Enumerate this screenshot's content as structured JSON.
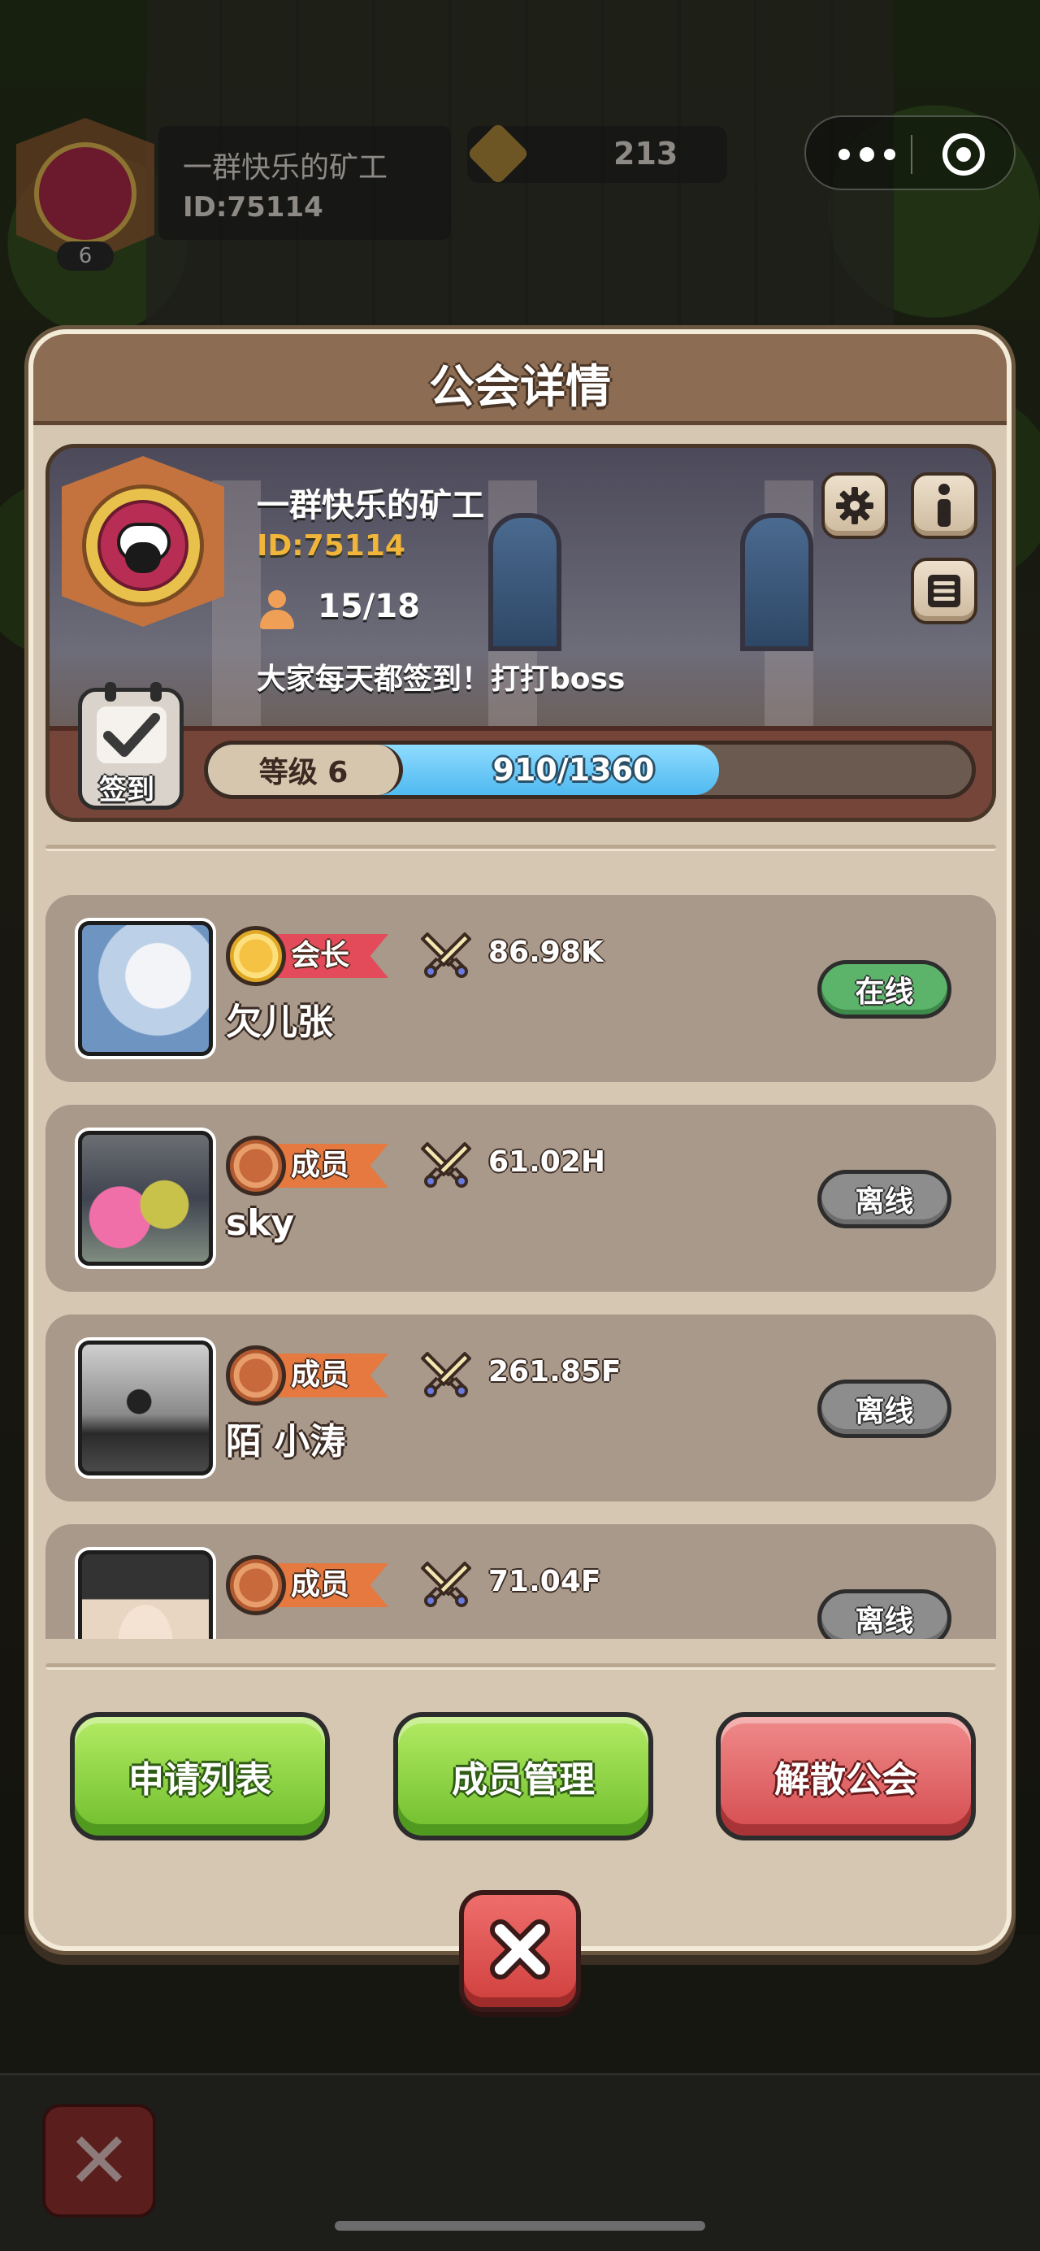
{
  "hud": {
    "guild_name": "一群快乐的矿工",
    "guild_id": "ID:75114",
    "guild_level": "6",
    "crown_count": "213"
  },
  "panel": {
    "title": "公会详情"
  },
  "guild": {
    "name": "一群快乐的矿工",
    "id": "ID:75114",
    "members_count": "15/18",
    "description": "大家每天都签到！打打boss",
    "checkin_label": "签到",
    "level_label": "等级 6",
    "exp_text": "910/1360",
    "exp_current": 910,
    "exp_max": 1360
  },
  "members": [
    {
      "role": "会长",
      "role_type": "leader",
      "power": "86.98K",
      "name": "欠儿张",
      "status": "在线",
      "status_type": "online"
    },
    {
      "role": "成员",
      "role_type": "member",
      "power": "61.02H",
      "name": "sky",
      "status": "离线",
      "status_type": "offline"
    },
    {
      "role": "成员",
      "role_type": "member",
      "power": "261.85F",
      "name": "陌 小涛",
      "status": "离线",
      "status_type": "offline"
    },
    {
      "role": "成员",
      "role_type": "member",
      "power": "71.04F",
      "name": "",
      "status": "离线",
      "status_type": "offline"
    }
  ],
  "actions": {
    "apply_list": "申请列表",
    "member_manage": "成员管理",
    "disband": "解散公会"
  },
  "colors": {
    "panel_bg": "#d5c7b2",
    "header_bg": "#8c6c52",
    "exp_fill": "#4fb9f0",
    "online": "#5cb46a",
    "offline": "#8d8d8d",
    "green_button": "#6fbe2d",
    "red_button": "#d44c4f",
    "guild_id_color": "#f1b53a"
  },
  "icons": {
    "settings": "gear-icon",
    "info": "info-icon",
    "list": "list-icon",
    "members": "person-icon",
    "power": "crossed-swords-icon",
    "close": "close-icon",
    "more": "more-icon",
    "miniapp_close": "target-icon"
  }
}
